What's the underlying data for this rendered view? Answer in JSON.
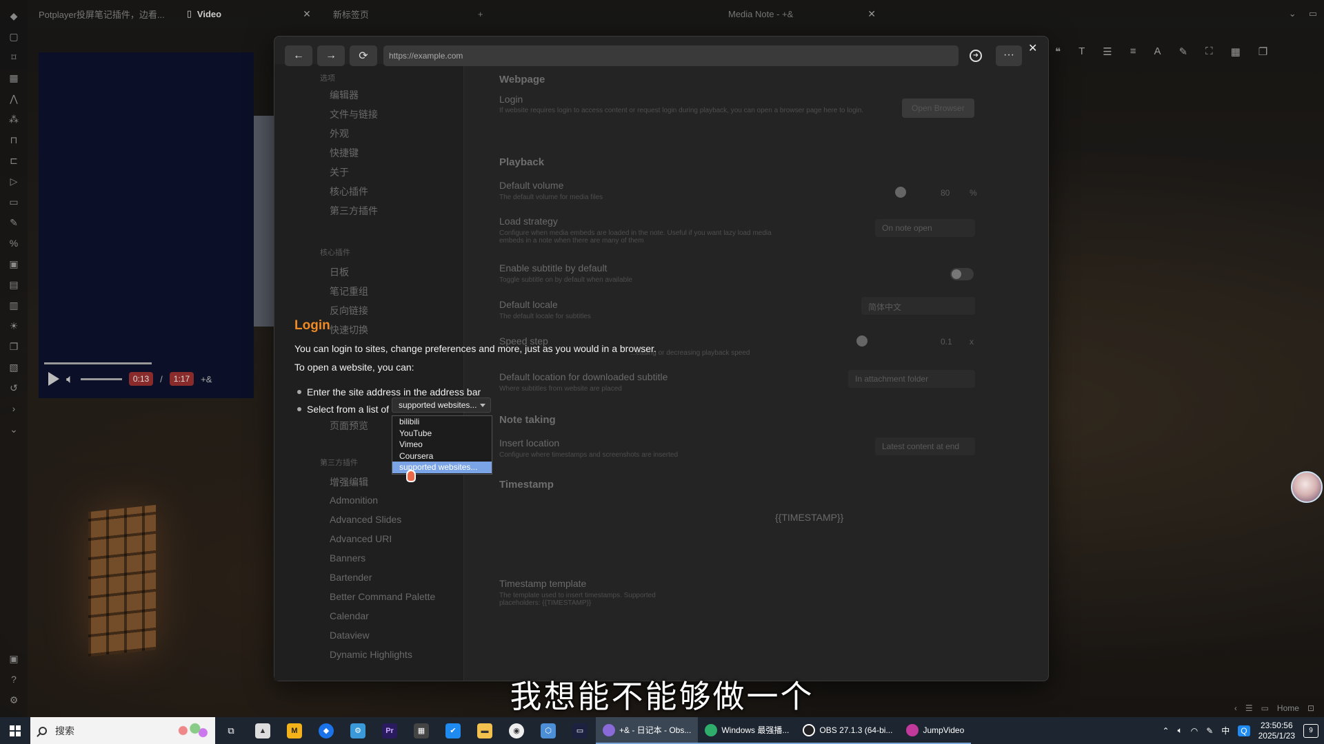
{
  "tabs": [
    {
      "label": "Potplayer投屏笔记插件，边看...",
      "active": false
    },
    {
      "label": "Video",
      "active": true
    },
    {
      "label": "新标签页",
      "active": false
    },
    {
      "label": "Media Note - +&",
      "active": false
    }
  ],
  "browser": {
    "back": "←",
    "forward": "→",
    "reload": "⟳",
    "url_placeholder": "https://example.com",
    "more": "···",
    "close": "✕"
  },
  "login": {
    "title": "Login",
    "line1": "You can login to sites, change preferences and more, just as you would in a browser.",
    "line2": "To open a website, you can:",
    "bullet1": "Enter the site address in the address bar",
    "bullet2": "Select from a list of",
    "select_value": "supported websites...",
    "options": [
      "bilibili",
      "YouTube",
      "Vimeo",
      "Coursera",
      "supported websites..."
    ],
    "selected_option": "supported websites..."
  },
  "settings_nav": {
    "group1": "选项",
    "items1": [
      "编辑器",
      "文件与链接",
      "外观",
      "快捷键",
      "关于",
      "核心插件",
      "第三方插件"
    ],
    "group2": "核心插件",
    "items2": [
      "日板",
      "笔记重组",
      "反向链接",
      "快速切换",
      "页面预览"
    ],
    "group3": "第三方插件",
    "items3": [
      "增强编辑",
      "Admonition",
      "Advanced Slides",
      "Advanced URI",
      "Banners",
      "Bartender",
      "Better Command Palette",
      "Calendar",
      "Dataview",
      "Dynamic Highlights"
    ]
  },
  "settings_content": {
    "webpage_heading": "Webpage",
    "login_title": "Login",
    "login_desc": "If website requires login to access content or request login during playback, you can open a browser page here to login.",
    "login_button": "Open Browser",
    "playback_heading": "Playback",
    "default_volume_title": "Default volume",
    "default_volume_desc": "The default volume for media files",
    "default_volume_value": "80",
    "default_volume_unit": "%",
    "load_strategy_title": "Load strategy",
    "load_strategy_desc": "Configure when media embeds are loaded in the note. Useful if you want lazy load media embeds in a note when there are many of them",
    "load_strategy_value": "On note open",
    "subtitle_title": "Enable subtitle by default",
    "subtitle_desc": "Toggle subtitle on by default when available",
    "locale_title": "Default locale",
    "locale_desc": "The default locale for subtitles",
    "locale_value": "简体中文",
    "speed_step_title": "Speed step",
    "speed_step_desc": "...easing or decreasing playback speed",
    "speed_step_value": "0.1",
    "speed_step_unit": "x",
    "dl_location_title": "Default location for downloaded subtitle",
    "dl_location_desc": "Where subtitles from website are placed",
    "dl_location_value": "In attachment folder",
    "note_taking_heading": "Note taking",
    "insert_location_title": "Insert location",
    "insert_location_desc": "Configure where timestamps and screenshots are inserted",
    "insert_location_value": "Latest content at end",
    "timestamp_heading": "Timestamp",
    "timestamp_value": "{{TIMESTAMP}}",
    "ts_template_title": "Timestamp template",
    "ts_template_desc": "The template used to insert timestamps. Supported placeholders: {{TIMESTAMP}}"
  },
  "player": {
    "current_time": "0:13",
    "separator": "/",
    "duration": "1:17",
    "extra": "+&"
  },
  "subtitle_text": "我想能不能够做一个",
  "status": {
    "home": "Home"
  },
  "taskbar": {
    "search_placeholder": "搜索",
    "apps": [
      {
        "label": "+& - 日记本 - Obs...",
        "color": "#8a6ad8",
        "active": true
      },
      {
        "label": "Windows 最强播...",
        "color": "#2fae6b",
        "active": false
      },
      {
        "label": "OBS 27.1.3 (64-bi...",
        "color": "#222222",
        "active": false
      },
      {
        "label": "JumpVideo",
        "color": "#c0399b",
        "active": false
      }
    ],
    "ime": "中",
    "time": "23:50:56",
    "date": "2025/1/23",
    "notifications": "9"
  },
  "colors": {
    "accent_orange": "#f08a24",
    "selected_option": "#7aa4e6",
    "timestamp_badge": "#8a2b2b"
  }
}
